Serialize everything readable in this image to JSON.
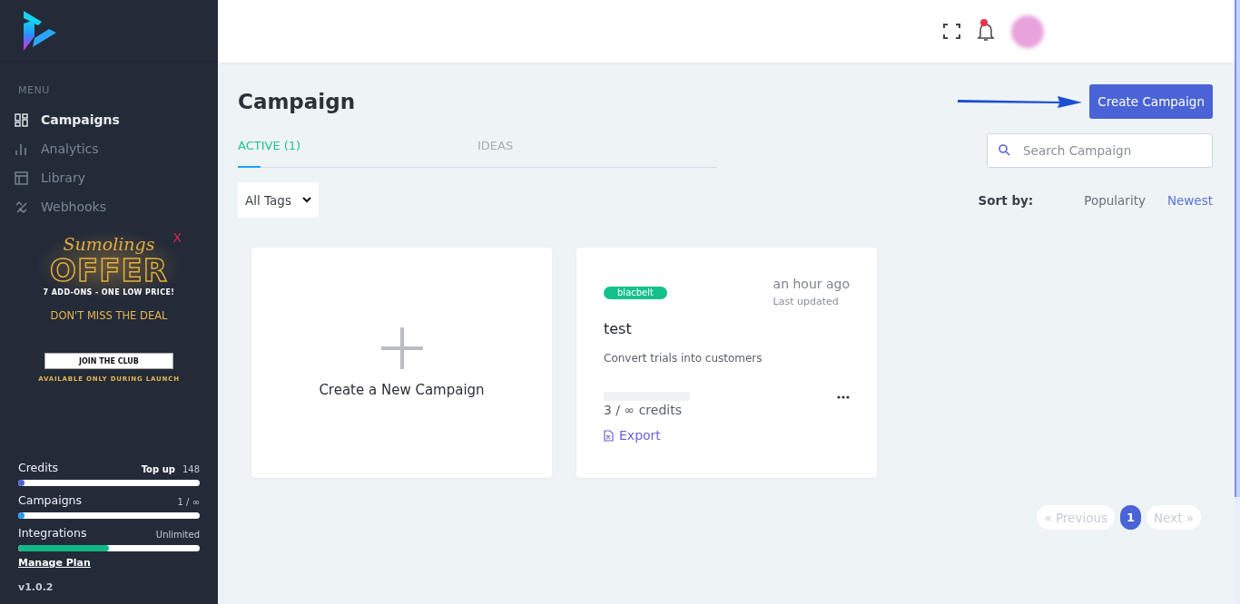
{
  "sidebar": {
    "menu_label": "MENU",
    "items": [
      {
        "label": "Campaigns",
        "kind": "grid",
        "selected": true
      },
      {
        "label": "Analytics",
        "kind": "bars",
        "selected": false
      },
      {
        "label": "Library",
        "kind": "layout",
        "selected": false
      },
      {
        "label": "Webhooks",
        "kind": "hook",
        "selected": false
      }
    ],
    "promo": {
      "close": "X",
      "script": "Sumolings",
      "headline": "OFFER",
      "subline": "7 ADD-ONS - ONE LOW PRICE!",
      "tagline": "DON'T MISS THE DEAL",
      "button": "JOIN THE CLUB",
      "footnote": "AVAILABLE ONLY DURING LAUNCH"
    },
    "usage": [
      {
        "label": "Credits",
        "link": "Top up",
        "value": "148",
        "level": 0.03,
        "color": "#4a63d6"
      },
      {
        "label": "Campaigns",
        "value": "1 / ∞",
        "level": 0.01,
        "color": "#1e9bf0"
      },
      {
        "label": "Integrations",
        "value": "Unlimited",
        "level": 0.5,
        "color": "#12b886"
      }
    ],
    "manage_plan": "Manage Plan",
    "version": "v1.0.2"
  },
  "main": {
    "title": "Campaign",
    "create_button": "Create Campaign",
    "tabs": [
      {
        "label": "ACTIVE (1)",
        "selected": true
      },
      {
        "label": "IDEAS",
        "selected": false
      }
    ],
    "search": {
      "placeholder": "Search Campaign"
    },
    "tag_filter": {
      "value": "All Tags"
    },
    "sort": {
      "label": "Sort by:",
      "options": [
        {
          "label": "Popularity",
          "selected": false
        },
        {
          "label": "Newest",
          "selected": true
        }
      ]
    },
    "new_card": {
      "label": "Create a New Campaign"
    },
    "campaigns": [
      {
        "tag": "blacbelt",
        "updated": "an hour ago",
        "updated_label": "Last updated",
        "title": "test",
        "description": "Convert trials into customers",
        "credits": "3 / ∞ credits",
        "export": "Export"
      }
    ],
    "pagination": {
      "previous": {
        "label": "« Previous",
        "disabled": true
      },
      "pages": [
        {
          "label": "1",
          "selected": true
        }
      ],
      "next": {
        "label": "Next »",
        "disabled": true
      }
    }
  }
}
